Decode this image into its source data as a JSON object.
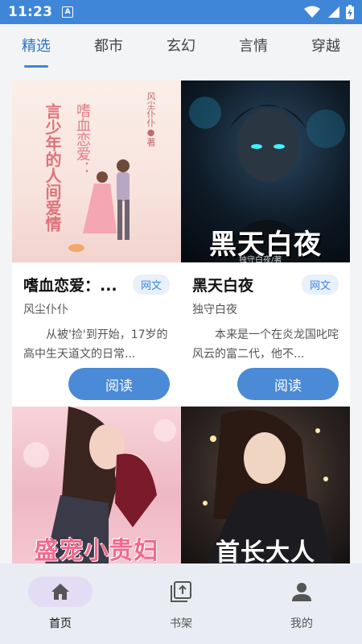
{
  "status": {
    "time": "11:23",
    "notif_letter": "A"
  },
  "tabs": [
    {
      "label": "精选",
      "active": true
    },
    {
      "label": "都市",
      "active": false
    },
    {
      "label": "玄幻",
      "active": false
    },
    {
      "label": "言情",
      "active": false
    },
    {
      "label": "穿越",
      "active": false
    }
  ],
  "books": [
    {
      "title": "嗜血恋爱：...",
      "tag": "网文",
      "author": "风尘仆仆",
      "desc": "从被'捡'到开始，17岁的高中生天道文的日常...",
      "read_label": "阅读",
      "cover": {
        "main": "言少年的人间爱情",
        "sub": "嗜血恋爱：",
        "author_mark": "风尘仆仆●著"
      }
    },
    {
      "title": "黑天白夜",
      "tag": "网文",
      "author": "独守白夜",
      "desc": "本来是一个在炎龙国叱咤风云的富二代，他不...",
      "read_label": "阅读",
      "cover": {
        "main": "黑天白夜",
        "author_mark": "独守白夜/著"
      }
    },
    {
      "cover": {
        "main": "盛宠小贵妇"
      }
    },
    {
      "cover": {
        "main": "首长大人"
      }
    }
  ],
  "bottom_nav": [
    {
      "label": "首页",
      "icon": "home-icon",
      "active": true
    },
    {
      "label": "书架",
      "icon": "bookshelf-icon",
      "active": false
    },
    {
      "label": "我的",
      "icon": "profile-icon",
      "active": false
    }
  ]
}
